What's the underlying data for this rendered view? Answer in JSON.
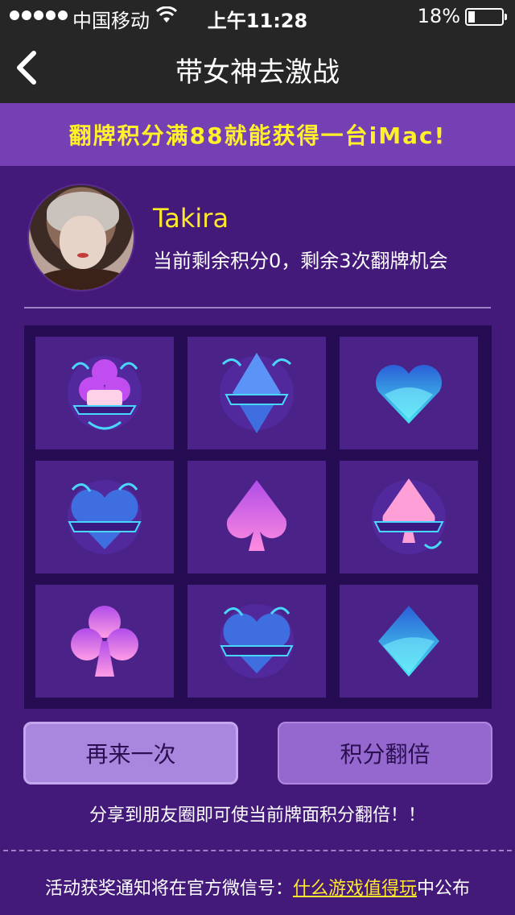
{
  "status_bar": {
    "carrier": "中国移动",
    "time": "上午11:28",
    "battery": "18%"
  },
  "nav": {
    "title": "带女神去激战"
  },
  "banner": {
    "text": "翻牌积分满88就能获得一台iMac!"
  },
  "profile": {
    "name": "Takira",
    "info": "当前剩余积分0，剩余3次翻牌机会"
  },
  "cards": [
    {
      "icon": "club-ornate-icon"
    },
    {
      "icon": "diamond-ornate-icon"
    },
    {
      "icon": "heart-icon"
    },
    {
      "icon": "heart-ornate-icon"
    },
    {
      "icon": "spade-icon"
    },
    {
      "icon": "spade-ornate-icon"
    },
    {
      "icon": "club-icon"
    },
    {
      "icon": "heart-ornate-icon"
    },
    {
      "icon": "diamond-icon"
    }
  ],
  "buttons": {
    "retry": "再来一次",
    "double": "积分翻倍"
  },
  "share_tip": "分享到朋友圈即可使当前牌面积分翻倍！！",
  "footer": {
    "prefix": "活动获奖通知将在官方微信号：",
    "link": "什么游戏值得玩",
    "suffix": "中公布"
  },
  "colors": {
    "background": "#43197a",
    "banner": "#7440b3",
    "highlight": "#ffe92d"
  }
}
